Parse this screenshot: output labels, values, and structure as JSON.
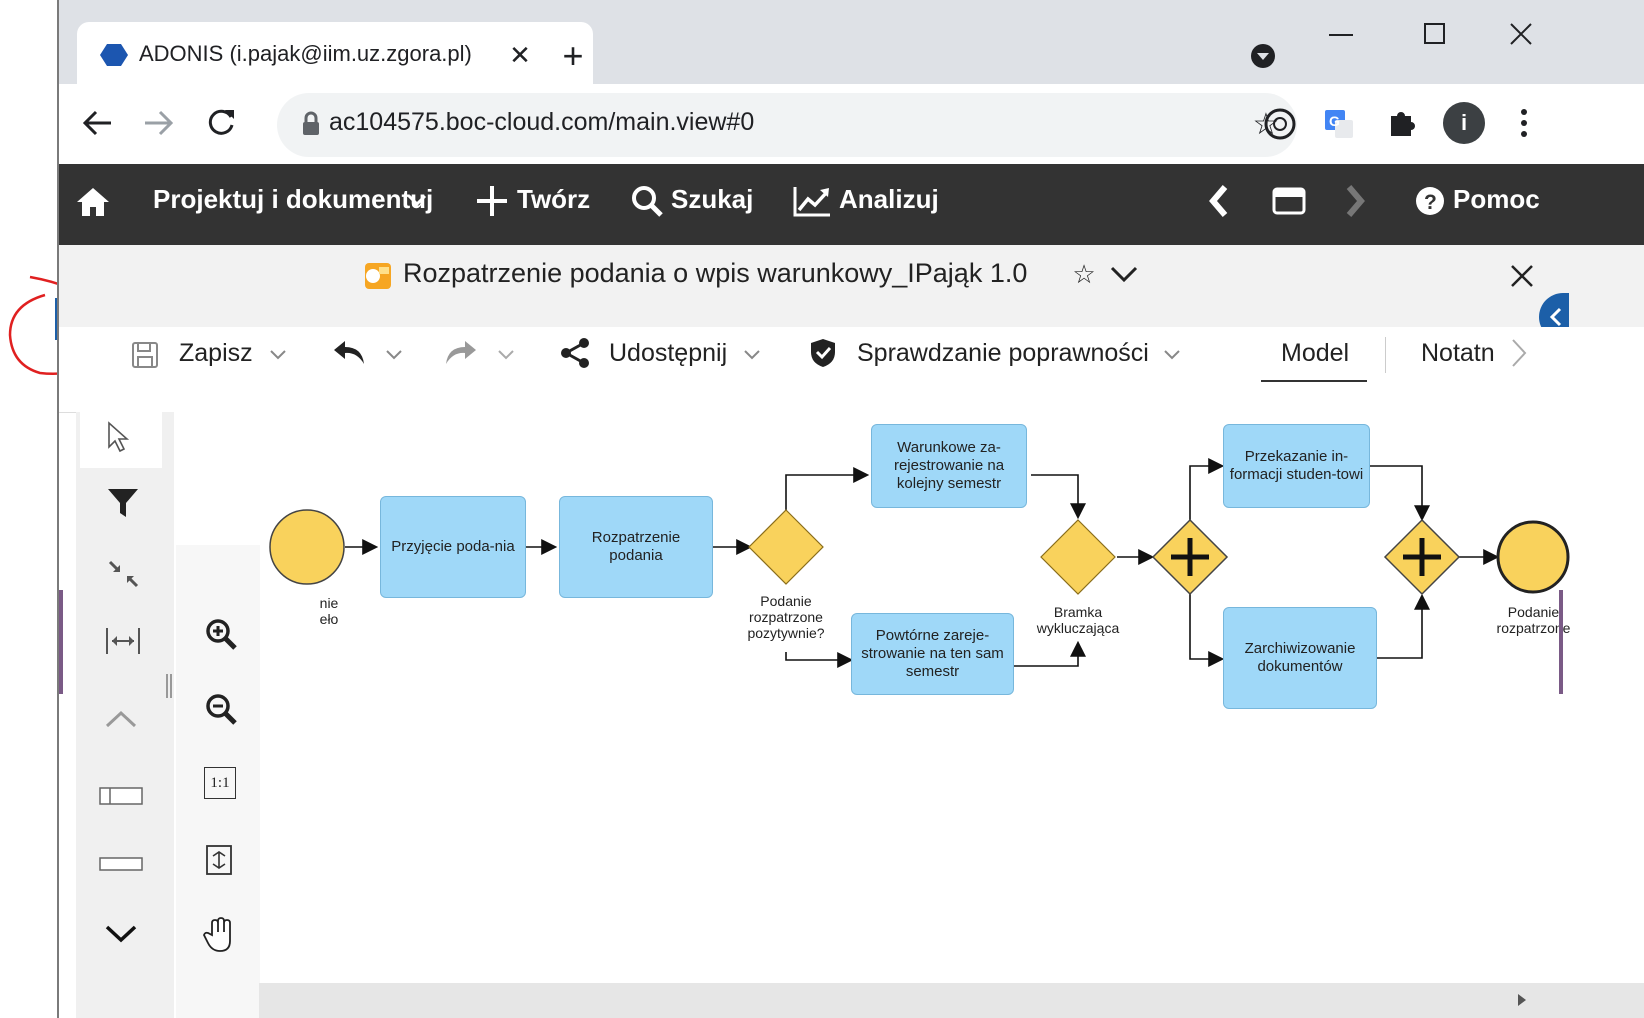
{
  "browser": {
    "tab_title": "ADONIS (i.pajak@iim.uz.zgora.pl)",
    "url": "ac104575.boc-cloud.com/main.view#0",
    "profile_initial": "i"
  },
  "app_nav": {
    "design_label": "Projektuj i dokumentuj",
    "create_label": "Twórz",
    "search_label": "Szukaj",
    "analyze_label": "Analizuj",
    "help_label": "Pomoc"
  },
  "document": {
    "title": "Rozpatrzenie podania o wpis warunkowy_IPająk 1.0"
  },
  "toolbar": {
    "save_label": "Zapisz",
    "share_label": "Udostępnij",
    "validation_label": "Sprawdzanie poprawności",
    "tab_model": "Model",
    "tab_notes": "Notatn"
  },
  "zoom": {
    "one_to_one": "1:1"
  },
  "diagram": {
    "start_label_line1": "nie",
    "start_label_line2": "eło",
    "task_receive": "Przyjęcie poda-nia",
    "task_review": "Rozpatrzenie podania",
    "gateway1_label": "Podanie rozpatrzone pozytywnie?",
    "task_conditional": "Warunkowe za-rejestrowanie na kolejny semestr",
    "task_repeat": "Powtórne zareje-strowanie na ten sam semestr",
    "gateway2_label": "Bramka wykluczająca",
    "task_inform": "Przekazanie in-formacji studen-towi",
    "task_archive": "Zarchiwizowanie dokumentów",
    "end_label": "Podanie rozpatrzone"
  },
  "colors": {
    "nav_bg": "#333333",
    "task_fill": "#9fd8f8",
    "event_fill": "#f9d25c",
    "annotation_red": "#e02020",
    "sidebar_toggle": "#1c5fa8"
  }
}
